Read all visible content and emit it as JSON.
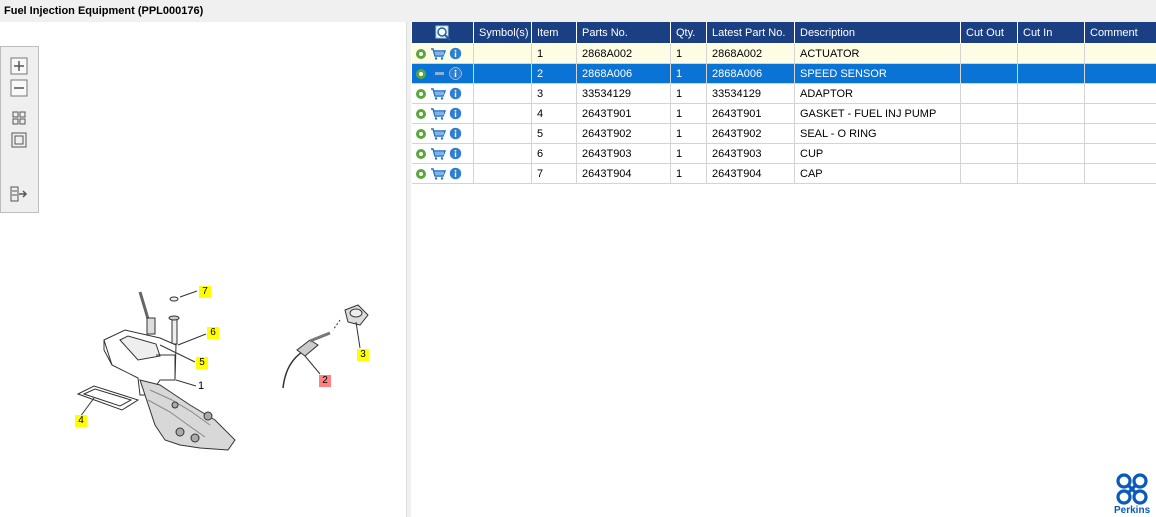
{
  "window": {
    "title": "Fuel Injection Equipment (PPL000176)"
  },
  "toolbar": {
    "buttons": [
      {
        "name": "zoom-in",
        "icon": "plus-icon"
      },
      {
        "name": "zoom-out",
        "icon": "minus-icon"
      },
      {
        "name": "fit-all",
        "icon": "grid-icon"
      },
      {
        "name": "actual-size",
        "icon": "square-icon"
      },
      {
        "name": "export",
        "icon": "export-icon"
      }
    ]
  },
  "drawing": {
    "callouts": [
      {
        "label": "7",
        "highlight": "yellow"
      },
      {
        "label": "6",
        "highlight": "yellow"
      },
      {
        "label": "5",
        "highlight": "yellow"
      },
      {
        "label": "1",
        "highlight": "none"
      },
      {
        "label": "4",
        "highlight": "yellow"
      },
      {
        "label": "3",
        "highlight": "yellow"
      },
      {
        "label": "2",
        "highlight": "red"
      }
    ]
  },
  "table": {
    "columns": [
      "",
      "Symbol(s)",
      "Item",
      "Parts No.",
      "Qty.",
      "Latest Part No.",
      "Description",
      "Cut Out",
      "Cut In",
      "Comment"
    ],
    "rows": [
      {
        "symbols": "",
        "item": "1",
        "part_no": "2868A002",
        "qty": "1",
        "latest_part_no": "2868A002",
        "description": "ACTUATOR",
        "cut_out": "",
        "cut_in": "",
        "comment": ""
      },
      {
        "symbols": "",
        "item": "2",
        "part_no": "2868A006",
        "qty": "1",
        "latest_part_no": "2868A006",
        "description": "SPEED SENSOR",
        "cut_out": "",
        "cut_in": "",
        "comment": ""
      },
      {
        "symbols": "",
        "item": "3",
        "part_no": "33534129",
        "qty": "1",
        "latest_part_no": "33534129",
        "description": "ADAPTOR",
        "cut_out": "",
        "cut_in": "",
        "comment": ""
      },
      {
        "symbols": "",
        "item": "4",
        "part_no": "2643T901",
        "qty": "1",
        "latest_part_no": "2643T901",
        "description": "GASKET - FUEL INJ PUMP",
        "cut_out": "",
        "cut_in": "",
        "comment": ""
      },
      {
        "symbols": "",
        "item": "5",
        "part_no": "2643T902",
        "qty": "1",
        "latest_part_no": "2643T902",
        "description": "SEAL - O RING",
        "cut_out": "",
        "cut_in": "",
        "comment": ""
      },
      {
        "symbols": "",
        "item": "6",
        "part_no": "2643T903",
        "qty": "1",
        "latest_part_no": "2643T903",
        "description": "CUP",
        "cut_out": "",
        "cut_in": "",
        "comment": ""
      },
      {
        "symbols": "",
        "item": "7",
        "part_no": "2643T904",
        "qty": "1",
        "latest_part_no": "2643T904",
        "description": "CAP",
        "cut_out": "",
        "cut_in": "",
        "comment": ""
      }
    ],
    "row_icons": [
      "gear-icon",
      "cart-icon",
      "info-icon"
    ]
  },
  "brand": {
    "name": "Perkins"
  },
  "colors": {
    "header": "#1a3f83",
    "selected_row": "#0a74d6",
    "highlight_row": "#fdfde6",
    "callout": "#ffff00",
    "callout_selected": "#ff8080",
    "brand": "#0a5bb8"
  }
}
